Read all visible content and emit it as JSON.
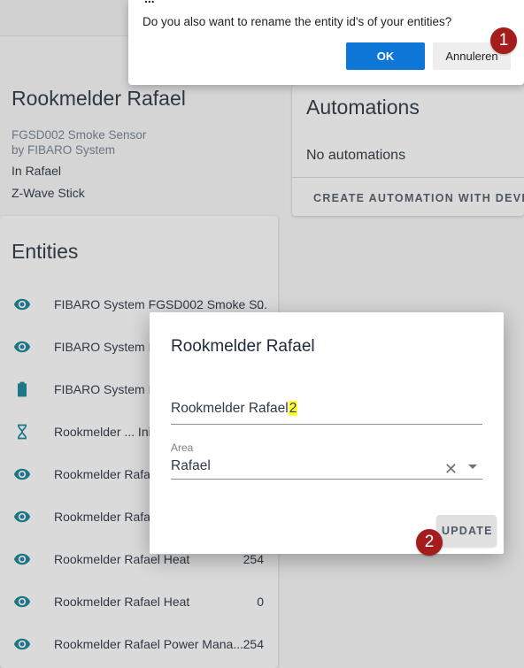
{
  "device": {
    "title": "Rookmelder Rafael",
    "model": "FGSD002 Smoke Sensor",
    "manufacturer": "by FIBARO System",
    "area": "In Rafael",
    "via": "Z-Wave Stick"
  },
  "automations": {
    "title": "Automations",
    "empty_text": "No automations",
    "create_label": "CREATE AUTOMATION WITH DEVICE"
  },
  "entities": {
    "title": "Entities",
    "rows": [
      {
        "icon": "eye-icon",
        "name": "FIBARO System FGSD002 Smoke S...",
        "state": "0"
      },
      {
        "icon": "eye-icon",
        "name": "FIBARO System F",
        "state": ""
      },
      {
        "icon": "battery-icon",
        "name": "FIBARO System F",
        "state": ""
      },
      {
        "icon": "hourglass-icon",
        "name": "Rookmelder ... Init",
        "state": ""
      },
      {
        "icon": "eye-icon",
        "name": "Rookmelder Rafa",
        "state": ""
      },
      {
        "icon": "eye-icon",
        "name": "Rookmelder Rafa",
        "state": ""
      },
      {
        "icon": "eye-icon",
        "name": "Rookmelder Rafael Heat",
        "state": "254"
      },
      {
        "icon": "eye-icon",
        "name": "Rookmelder Rafael Heat",
        "state": "0"
      },
      {
        "icon": "eye-icon",
        "name": "Rookmelder Rafael Power Mana...",
        "state": "254"
      }
    ]
  },
  "confirm_dialog": {
    "title_fragment": "...",
    "text": "Do you also want to rename the entity id's of your entities?",
    "ok_label": "OK",
    "cancel_label": "Annuleren"
  },
  "edit_dialog": {
    "title": "Rookmelder Rafael",
    "name_value_base": "Rookmelder Rafael",
    "name_value_highlight": "2",
    "area_label": "Area",
    "area_value": "Rafael",
    "update_label": "UPDATE"
  },
  "markers": {
    "one": "1",
    "two": "2"
  },
  "colors": {
    "accent_blue": "#0d76d6",
    "icon_teal": "#1f7a8c",
    "marker_red": "#a51c1c"
  }
}
